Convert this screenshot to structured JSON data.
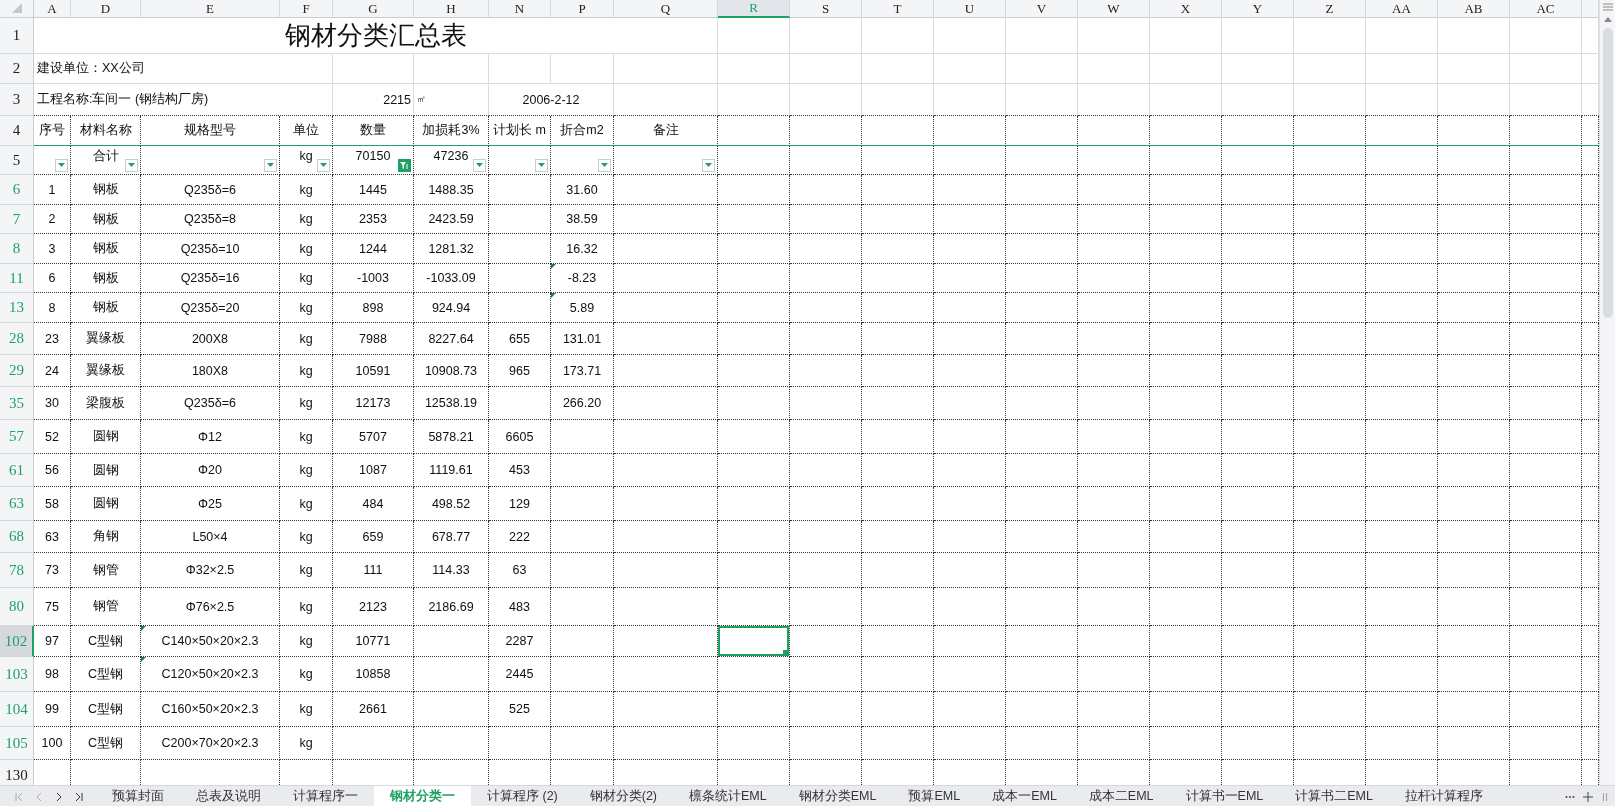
{
  "columns": [
    {
      "label": "A",
      "selected": false
    },
    {
      "label": "D",
      "selected": false
    },
    {
      "label": "E",
      "selected": false
    },
    {
      "label": "F",
      "selected": false
    },
    {
      "label": "G",
      "selected": false
    },
    {
      "label": "H",
      "selected": false
    },
    {
      "label": "N",
      "selected": false
    },
    {
      "label": "P",
      "selected": false
    },
    {
      "label": "Q",
      "selected": false
    },
    {
      "label": "R",
      "selected": true
    },
    {
      "label": "S",
      "selected": false
    },
    {
      "label": "T",
      "selected": false
    },
    {
      "label": "U",
      "selected": false
    },
    {
      "label": "V",
      "selected": false
    },
    {
      "label": "W",
      "selected": false
    },
    {
      "label": "X",
      "selected": false
    },
    {
      "label": "Y",
      "selected": false
    },
    {
      "label": "Z",
      "selected": false
    },
    {
      "label": "AA",
      "selected": false
    },
    {
      "label": "AB",
      "selected": false
    },
    {
      "label": "AC",
      "selected": false
    }
  ],
  "title_row": {
    "number": "1",
    "text": "钢材分类汇总表"
  },
  "builder_row": {
    "number": "2",
    "text": "建设单位：XX公司"
  },
  "project_row": {
    "number": "3",
    "text": "工程名称:车间一 (钢结构厂房)",
    "area": "2215",
    "area_unit": "㎡",
    "date": "2006-2-12"
  },
  "header_row": {
    "number": "4",
    "labels": [
      "序号",
      "材料名称",
      "规格型号",
      "单位",
      "数量",
      "加损耗3%",
      "计划长 m",
      "折合m2",
      "备注"
    ]
  },
  "filter_row": {
    "number": "5",
    "cells": [
      {
        "filter_active": false
      },
      {
        "text": "合计",
        "filter_active": false
      },
      {
        "filter_active": false
      },
      {
        "text": "kg",
        "filter_active": false
      },
      {
        "text": "70150",
        "filter_active": true
      },
      {
        "text": "47236",
        "filter_active": false
      },
      {
        "filter_active": false
      },
      {
        "filter_active": false
      },
      {
        "filter_active": false
      }
    ]
  },
  "rows": [
    {
      "number": "6",
      "filtered": true,
      "selected": false,
      "spec_marked": false,
      "converted_marked": false,
      "no": "1",
      "material": "钢板",
      "spec": "Q235δ=6",
      "unit": "kg",
      "qty": "1445",
      "with_loss": "1488.35",
      "converted": "31.60"
    },
    {
      "number": "7",
      "filtered": true,
      "selected": false,
      "spec_marked": false,
      "converted_marked": false,
      "no": "2",
      "material": "钢板",
      "spec": "Q235δ=8",
      "unit": "kg",
      "qty": "2353",
      "with_loss": "2423.59",
      "converted": "38.59"
    },
    {
      "number": "8",
      "filtered": true,
      "selected": false,
      "spec_marked": false,
      "converted_marked": false,
      "no": "3",
      "material": "钢板",
      "spec": "Q235δ=10",
      "unit": "kg",
      "qty": "1244",
      "with_loss": "1281.32",
      "converted": "16.32"
    },
    {
      "number": "11",
      "filtered": true,
      "selected": false,
      "spec_marked": false,
      "converted_marked": true,
      "no": "6",
      "material": "钢板",
      "spec": "Q235δ=16",
      "unit": "kg",
      "qty": "-1003",
      "with_loss": "-1033.09",
      "converted": "-8.23"
    },
    {
      "number": "13",
      "filtered": true,
      "selected": false,
      "spec_marked": false,
      "converted_marked": true,
      "no": "8",
      "material": "钢板",
      "spec": "Q235δ=20",
      "unit": "kg",
      "qty": "898",
      "with_loss": "924.94",
      "converted": "5.89"
    },
    {
      "number": "28",
      "filtered": true,
      "selected": false,
      "spec_marked": false,
      "converted_marked": false,
      "no": "23",
      "material": "翼缘板",
      "spec": "200X8",
      "unit": "kg",
      "qty": "7988",
      "with_loss": "8227.64",
      "length": "655",
      "converted": "131.01"
    },
    {
      "number": "29",
      "filtered": true,
      "selected": false,
      "spec_marked": false,
      "converted_marked": false,
      "no": "24",
      "material": "翼缘板",
      "spec": "180X8",
      "unit": "kg",
      "qty": "10591",
      "with_loss": "10908.73",
      "length": "965",
      "converted": "173.71"
    },
    {
      "number": "35",
      "filtered": true,
      "selected": false,
      "spec_marked": false,
      "converted_marked": false,
      "no": "30",
      "material": "梁腹板",
      "spec": "Q235δ=6",
      "unit": "kg",
      "qty": "12173",
      "with_loss": "12538.19",
      "converted": "266.20"
    },
    {
      "number": "57",
      "filtered": true,
      "selected": false,
      "spec_marked": false,
      "converted_marked": false,
      "no": "52",
      "material": "圆钢",
      "spec": "Φ12",
      "unit": "kg",
      "qty": "5707",
      "with_loss": "5878.21",
      "length": "6605"
    },
    {
      "number": "61",
      "filtered": true,
      "selected": false,
      "spec_marked": false,
      "converted_marked": false,
      "no": "56",
      "material": "圆钢",
      "spec": "Φ20",
      "unit": "kg",
      "qty": "1087",
      "with_loss": "1119.61",
      "length": "453"
    },
    {
      "number": "63",
      "filtered": true,
      "selected": false,
      "spec_marked": false,
      "converted_marked": false,
      "no": "58",
      "material": "圆钢",
      "spec": "Φ25",
      "unit": "kg",
      "qty": "484",
      "with_loss": "498.52",
      "length": "129"
    },
    {
      "number": "68",
      "filtered": true,
      "selected": false,
      "spec_marked": false,
      "converted_marked": false,
      "no": "63",
      "material": "角钢",
      "spec": "L50×4",
      "unit": "kg",
      "qty": "659",
      "with_loss": "678.77",
      "length": "222"
    },
    {
      "number": "78",
      "filtered": true,
      "selected": false,
      "spec_marked": false,
      "converted_marked": false,
      "no": "73",
      "material": "钢管",
      "spec": "Φ32×2.5",
      "unit": "kg",
      "qty": "111",
      "with_loss": "114.33",
      "length": "63"
    },
    {
      "number": "80",
      "filtered": true,
      "selected": false,
      "spec_marked": false,
      "converted_marked": false,
      "no": "75",
      "material": "钢管",
      "spec": "Φ76×2.5",
      "unit": "kg",
      "qty": "2123",
      "with_loss": "2186.69",
      "length": "483"
    },
    {
      "number": "102",
      "filtered": true,
      "selected": true,
      "spec_marked": true,
      "converted_marked": false,
      "no": "97",
      "material": "C型钢",
      "spec": "C140×50×20×2.3",
      "unit": "kg",
      "qty": "10771",
      "length": "2287"
    },
    {
      "number": "103",
      "filtered": true,
      "selected": false,
      "spec_marked": true,
      "converted_marked": false,
      "no": "98",
      "material": "C型钢",
      "spec": "C120×50×20×2.3",
      "unit": "kg",
      "qty": "10858",
      "length": "2445"
    },
    {
      "number": "104",
      "filtered": true,
      "selected": false,
      "spec_marked": false,
      "converted_marked": false,
      "no": "99",
      "material": "C型钢",
      "spec": "C160×50×20×2.3",
      "unit": "kg",
      "qty": "2661",
      "length": "525"
    },
    {
      "number": "105",
      "filtered": true,
      "selected": false,
      "spec_marked": false,
      "converted_marked": false,
      "no": "100",
      "material": "C型钢",
      "spec": "C200×70×20×2.3",
      "unit": "kg"
    },
    {
      "number": "130",
      "filtered": false,
      "selected": false,
      "spec_marked": false,
      "converted_marked": false
    }
  ],
  "sheet_tabs": [
    {
      "label": "预算封面",
      "selected": false
    },
    {
      "label": "总表及说明",
      "selected": false
    },
    {
      "label": "计算程序一",
      "selected": false
    },
    {
      "label": "钢材分类一",
      "selected": true
    },
    {
      "label": "计算程序 (2)",
      "selected": false
    },
    {
      "label": "钢材分类(2)",
      "selected": false
    },
    {
      "label": "檩条统计EML",
      "selected": false
    },
    {
      "label": "钢材分类EML",
      "selected": false
    },
    {
      "label": "预算EML",
      "selected": false
    },
    {
      "label": "成本一EML",
      "selected": false
    },
    {
      "label": "成本二EML",
      "selected": false
    },
    {
      "label": "计算书一EML",
      "selected": false
    },
    {
      "label": "计算书二EML",
      "selected": false
    },
    {
      "label": "拉杆计算程序",
      "selected": false
    }
  ]
}
